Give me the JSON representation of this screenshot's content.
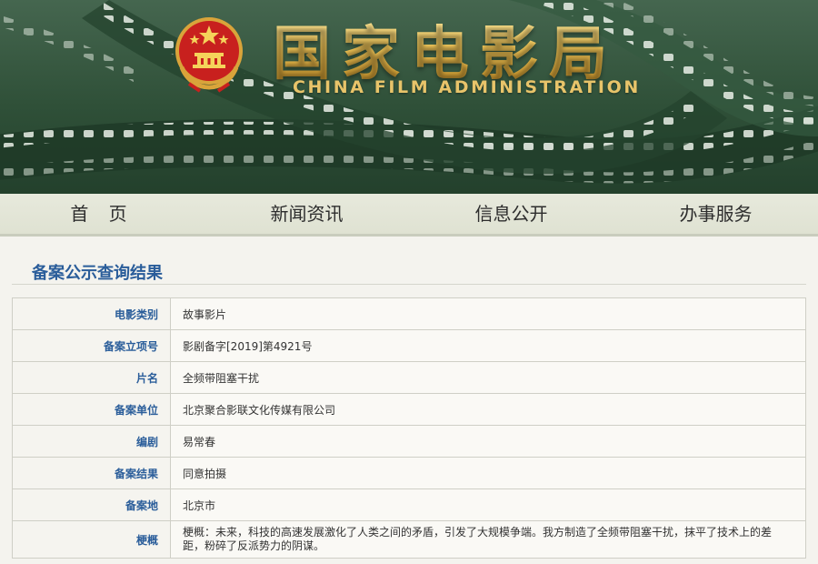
{
  "header": {
    "title": "国家电影局",
    "subtitle": "CHINA FILM ADMINISTRATION"
  },
  "nav": {
    "items": [
      {
        "label": "首 页"
      },
      {
        "label": "新闻资讯"
      },
      {
        "label": "信息公开"
      },
      {
        "label": "办事服务"
      }
    ]
  },
  "result": {
    "title": "备案公示查询结果",
    "rows": [
      {
        "label": "电影类别",
        "value": "故事影片"
      },
      {
        "label": "备案立项号",
        "value": "影剧备字[2019]第4921号"
      },
      {
        "label": "片名",
        "value": "全频带阻塞干扰"
      },
      {
        "label": "备案单位",
        "value": "北京聚合影联文化传媒有限公司"
      },
      {
        "label": "编剧",
        "value": "易常春"
      },
      {
        "label": "备案结果",
        "value": "同意拍摄"
      },
      {
        "label": "备案地",
        "value": "北京市"
      },
      {
        "label": "梗概",
        "value": "梗概：未来，科技的高速发展激化了人类之间的矛盾，引发了大规模争端。我方制造了全频带阻塞干扰，抹平了技术上的差距，粉碎了反派势力的阴谋。"
      }
    ]
  },
  "colors": {
    "banner_green": "#2f5038",
    "title_gold": "#f0c659",
    "label_blue": "#2a5d9a",
    "emblem_red": "#c8201e"
  },
  "icons": {
    "emblem": "national-emblem-icon"
  }
}
